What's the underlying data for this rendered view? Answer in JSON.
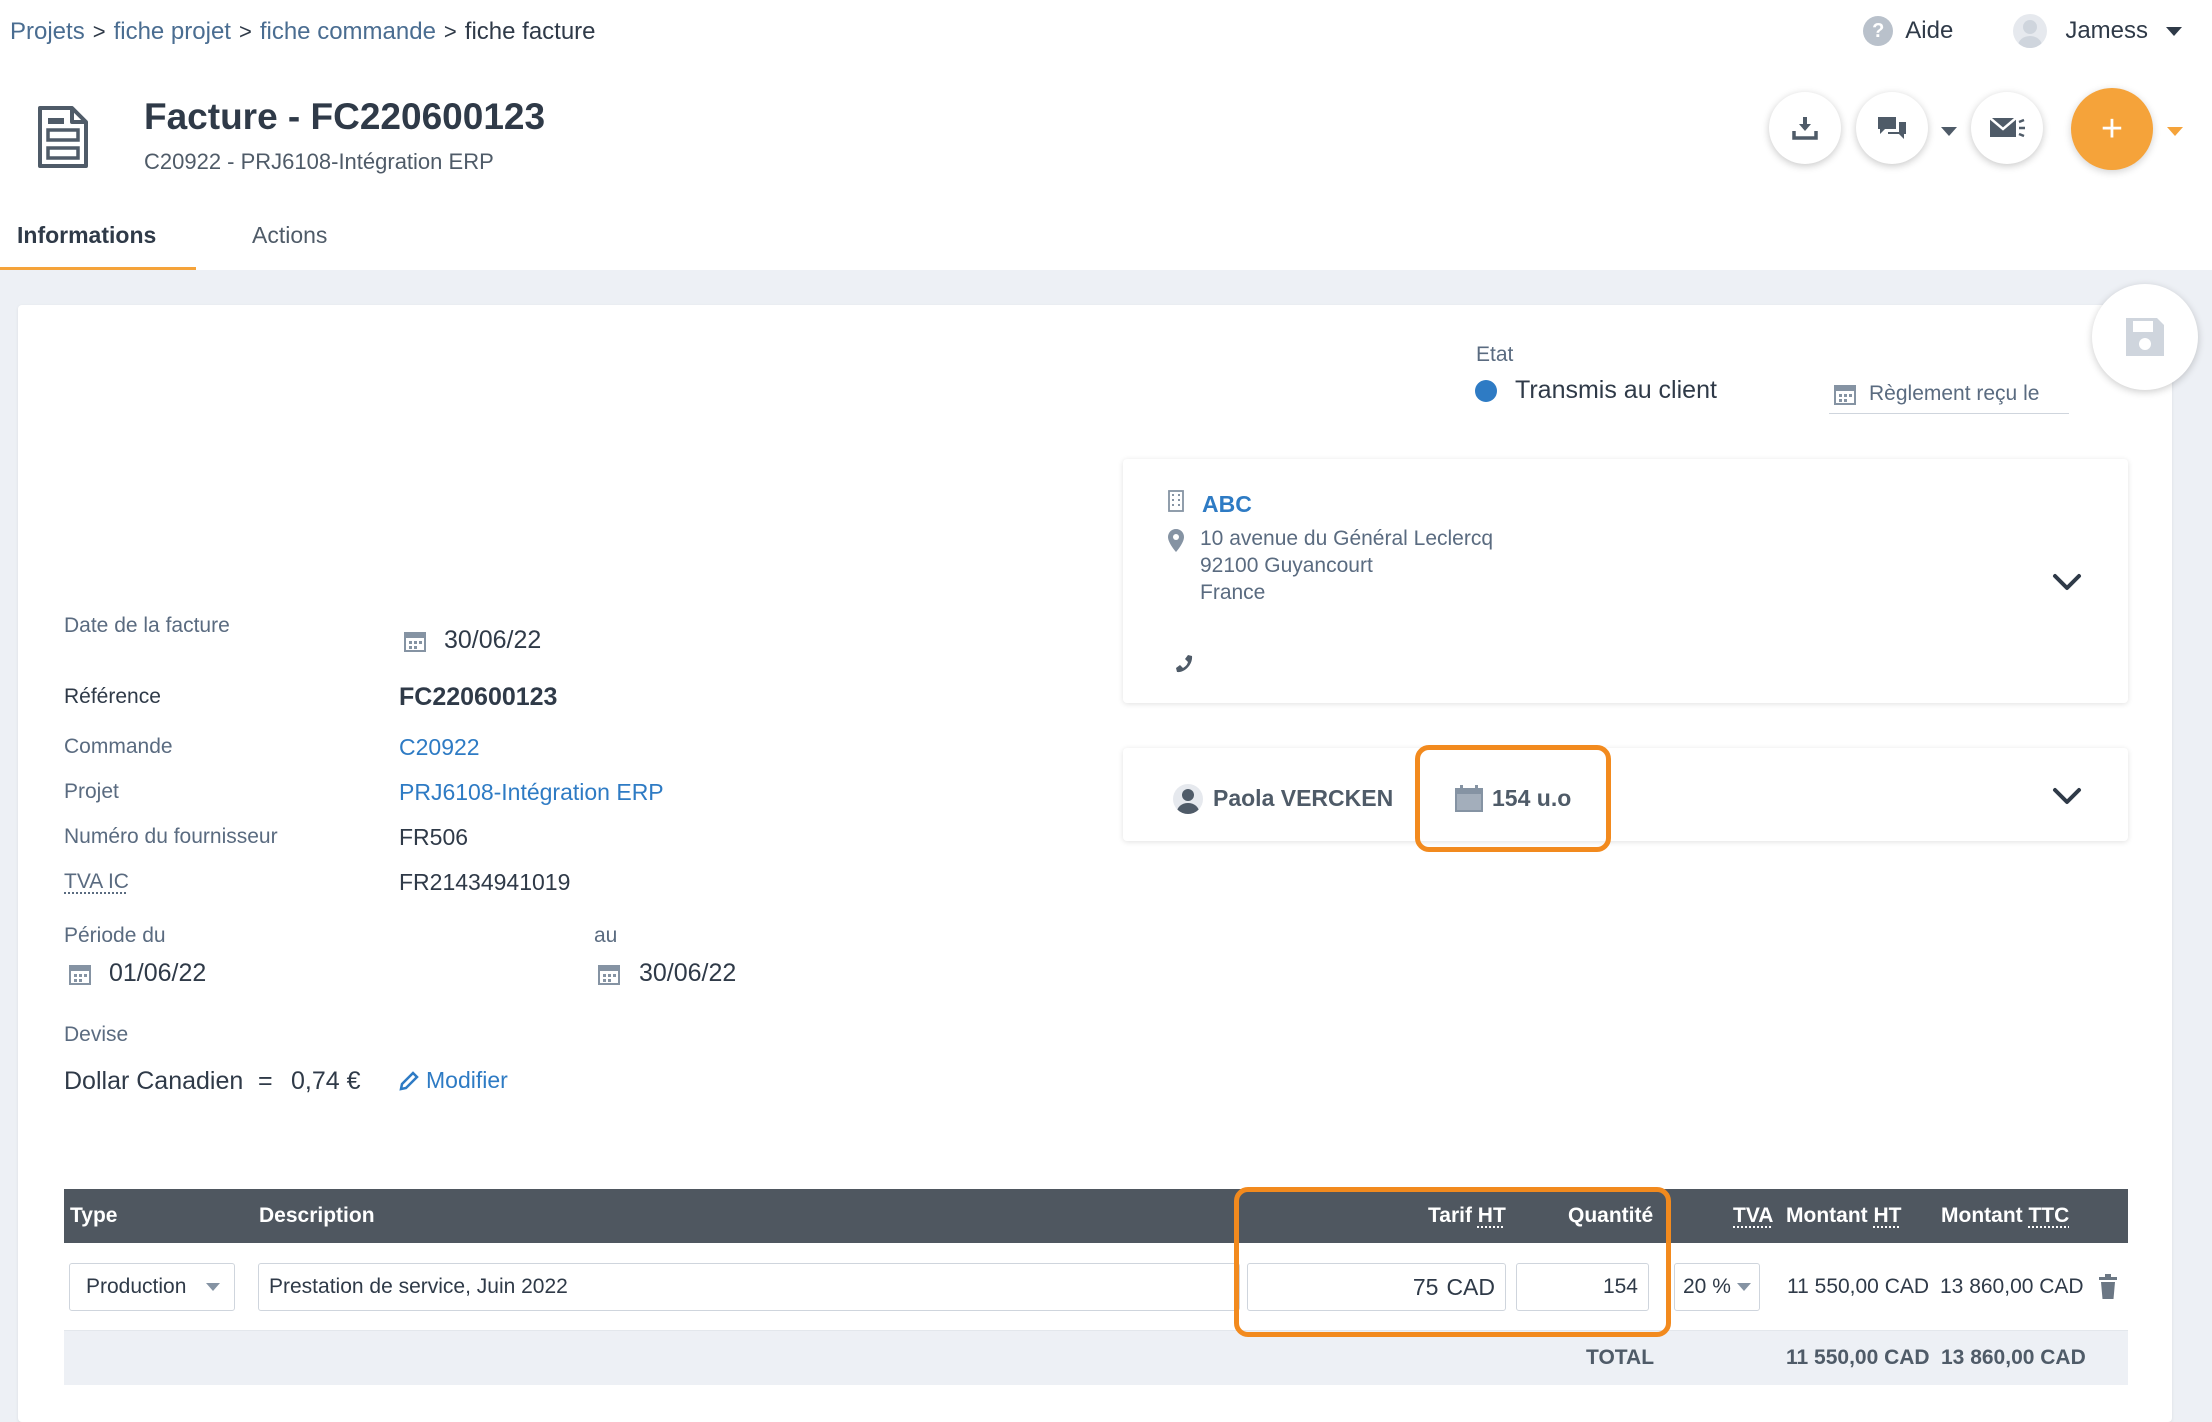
{
  "breadcrumb": {
    "items": [
      "Projets",
      "fiche projet",
      "fiche commande",
      "fiche facture"
    ],
    "sep": ">"
  },
  "topbar": {
    "help_label": "Aide",
    "user_name": "Jamess"
  },
  "header": {
    "title": "Facture - FC220600123",
    "subtitle": "C20922 - PRJ6108-Intégration ERP",
    "plus_label": "+"
  },
  "tabs": [
    {
      "label": "Informations",
      "active": true
    },
    {
      "label": "Actions",
      "active": false
    }
  ],
  "status": {
    "label": "Etat",
    "value": "Transmis au client",
    "color": "#2e7bc4",
    "payment_placeholder": "Règlement reçu le"
  },
  "invoice": {
    "date_label": "Date de la facture",
    "date_value": "30/06/22",
    "ref_label": "Référence",
    "ref_value": "FC220600123",
    "order_label": "Commande",
    "order_value": "C20922",
    "project_label": "Projet",
    "project_value": "PRJ6108-Intégration ERP",
    "supplier_label": "Numéro du fournisseur",
    "supplier_value": "FR506",
    "vat_label": "TVA IC",
    "vat_value": "FR21434941019",
    "period_from_label": "Période du",
    "period_from_value": "01/06/22",
    "period_to_label": "au",
    "period_to_value": "30/06/22",
    "currency_label": "Devise",
    "currency_name": "Dollar Canadien",
    "currency_eq": "=",
    "currency_rate": "0,74 €",
    "modify_label": "Modifier"
  },
  "client": {
    "name": "ABC",
    "address_line1": "10 avenue du Général Leclercq",
    "address_line2": "92100 Guyancourt",
    "address_line3": "France"
  },
  "contact": {
    "name": "Paola VERCKEN",
    "units": "154 u.o"
  },
  "table": {
    "headers": {
      "type": "Type",
      "description": "Description",
      "tarif_prefix": "Tarif ",
      "tarif_suffix": "HT",
      "quantity": "Quantité",
      "tva": "TVA",
      "montant_ht_prefix": "Montant ",
      "montant_ht_suffix": "HT",
      "montant_ttc_prefix": "Montant ",
      "montant_ttc_suffix": "TTC"
    },
    "row": {
      "type": "Production",
      "description": "Prestation de service, Juin 2022",
      "tarif": "75",
      "tarif_currency": "CAD",
      "quantity": "154",
      "tva": "20 %",
      "montant_ht": "11 550,00 CAD",
      "montant_ttc": "13 860,00 CAD"
    },
    "footer": {
      "label": "TOTAL",
      "montant_ht": "11 550,00 CAD",
      "montant_ttc": "13 860,00 CAD"
    }
  },
  "colors": {
    "accent": "#f5a33a",
    "highlight": "#f28a1e",
    "link": "#2e7bc4",
    "table_header": "#4f5760"
  }
}
